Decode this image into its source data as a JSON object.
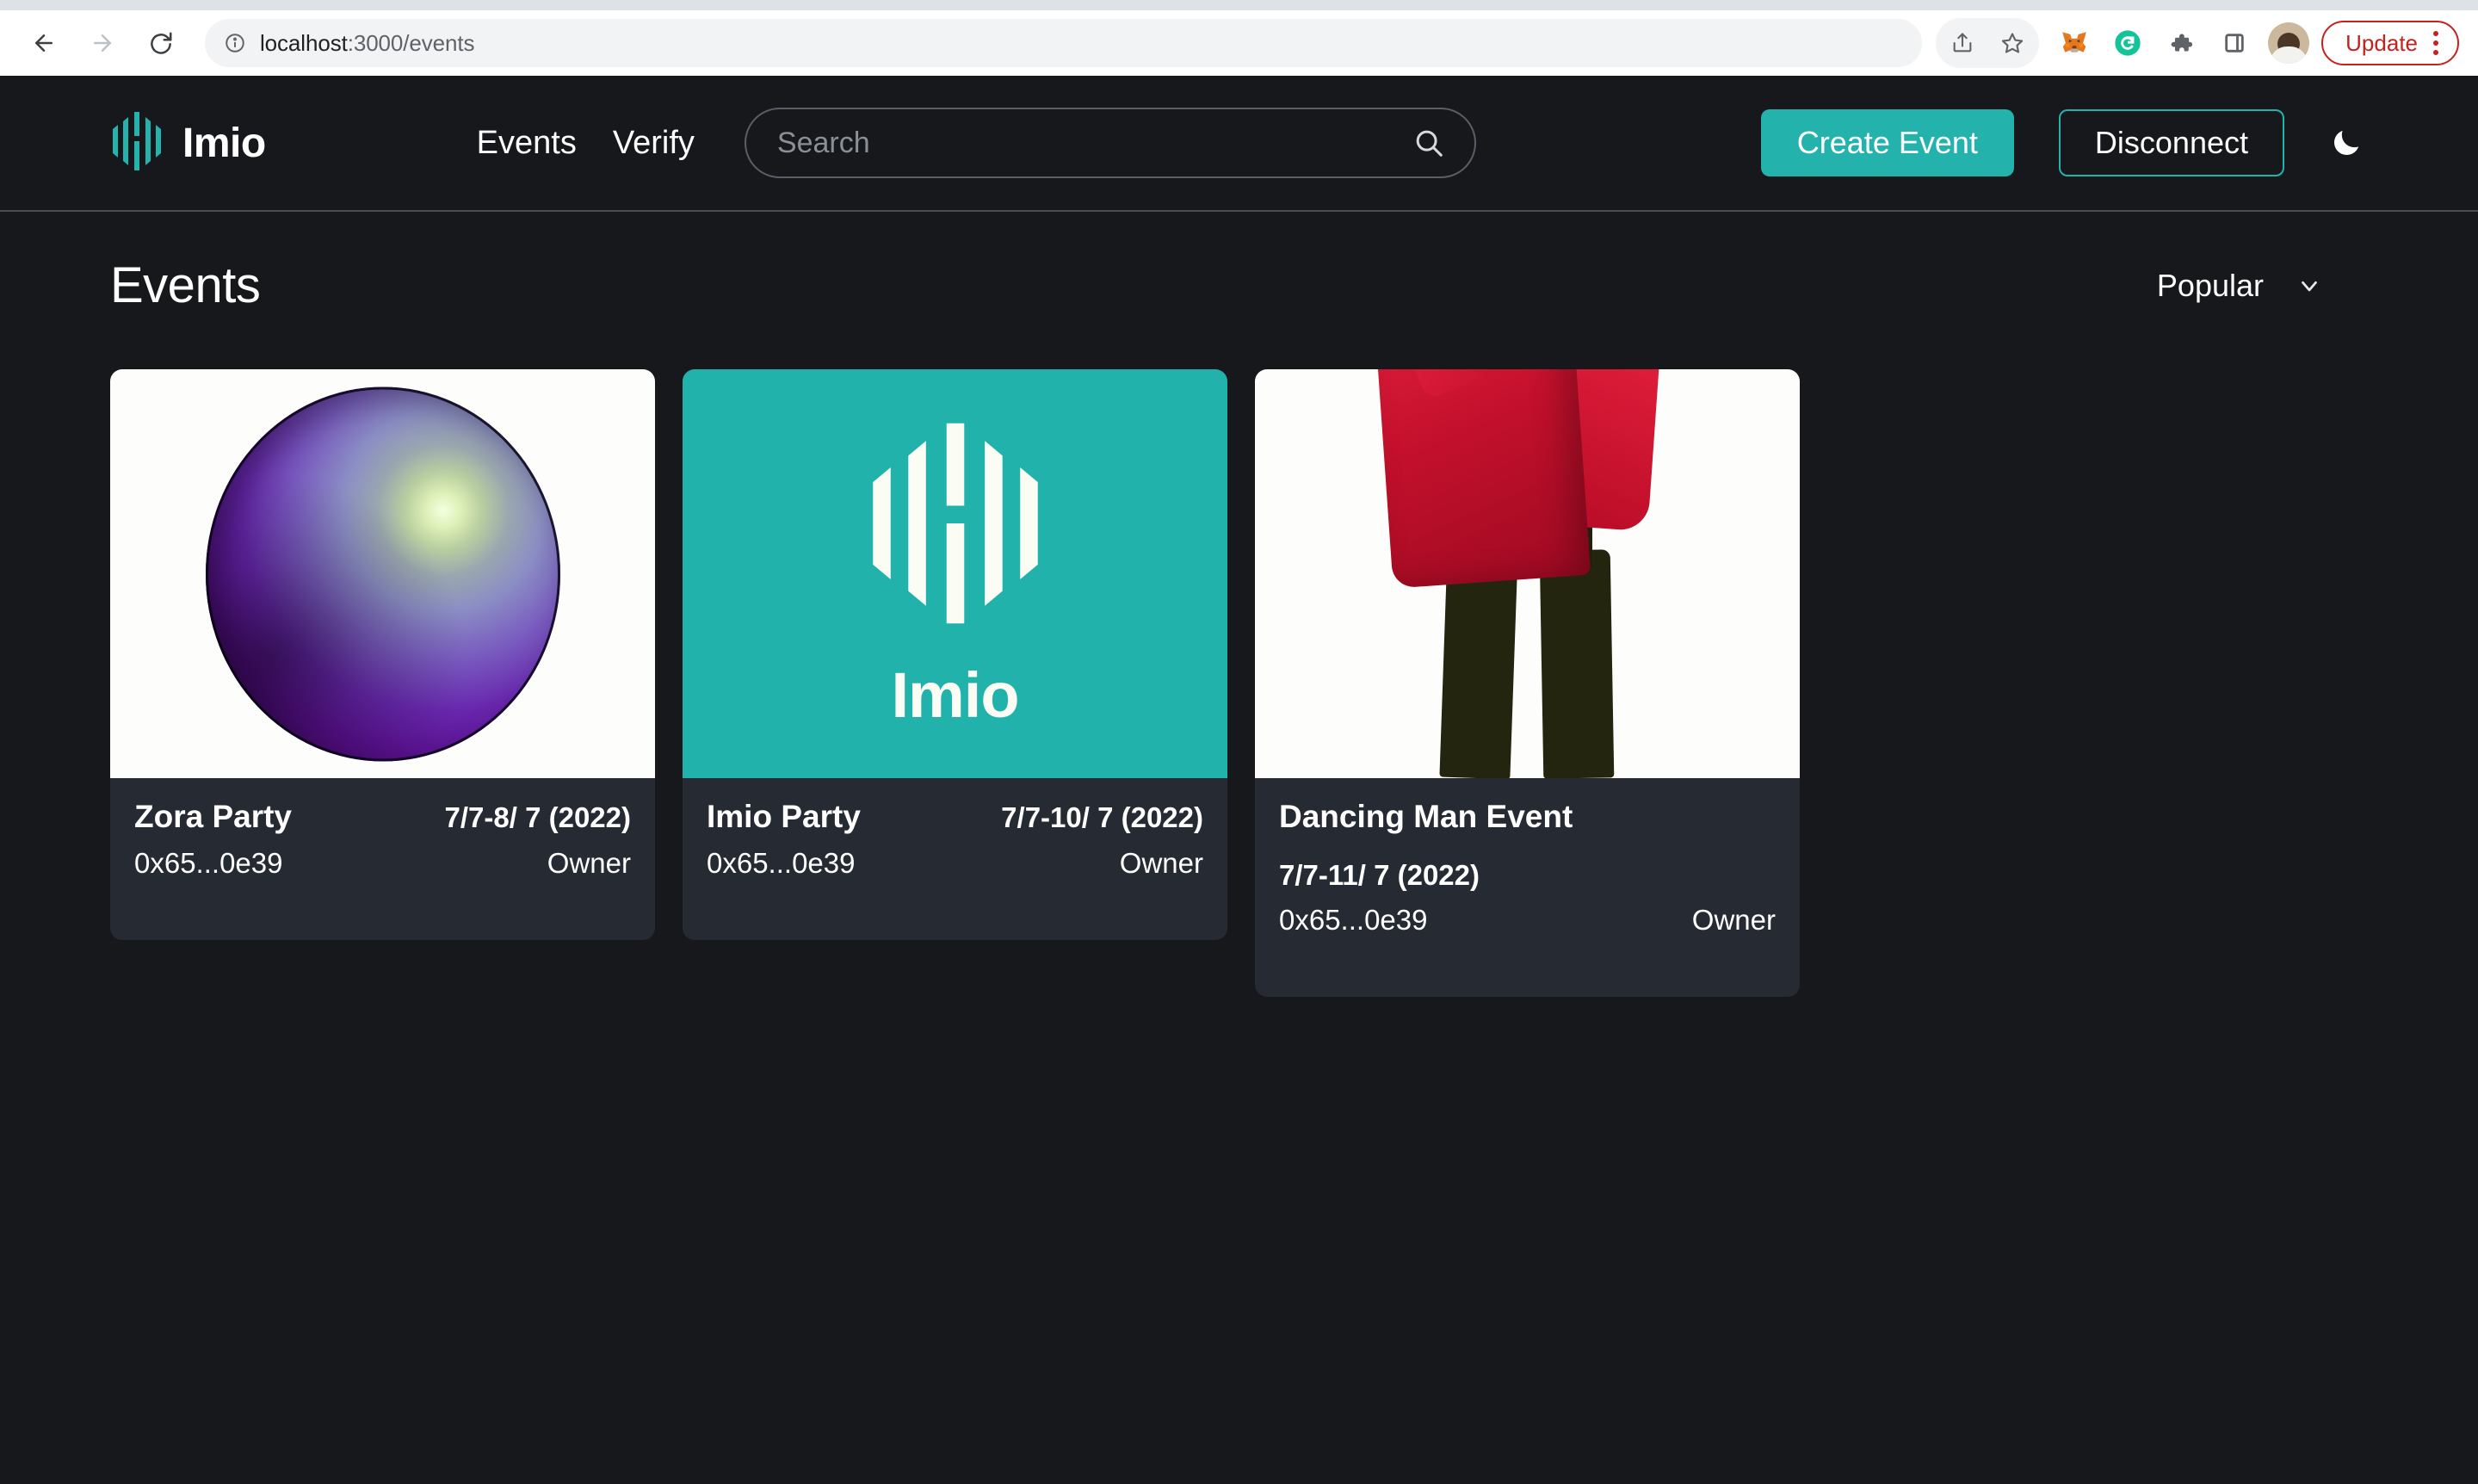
{
  "browser": {
    "back_icon": "back-arrow-icon",
    "forward_icon": "forward-arrow-icon",
    "reload_icon": "reload-icon",
    "site_info_icon": "site-info-icon",
    "url_host": "localhost",
    "url_path": ":3000/events",
    "url_full": "localhost:3000/events",
    "share_icon": "share-icon",
    "bookmark_icon": "bookmark-star-icon",
    "metamask_icon": "metamask-fox-icon",
    "grammarly_icon": "grammarly-icon",
    "extensions_icon": "extensions-puzzle-icon",
    "sidepanel_icon": "side-panel-icon",
    "avatar_icon": "profile-avatar",
    "update_label": "Update",
    "menu_icon": "three-dot-menu-icon"
  },
  "header": {
    "brand_name": "Imio",
    "logo_icon": "imio-logo-icon",
    "nav": [
      {
        "label": "Events"
      },
      {
        "label": "Verify"
      }
    ],
    "search": {
      "placeholder": "Search",
      "value": "",
      "icon": "search-icon"
    },
    "create_event_label": "Create Event",
    "disconnect_label": "Disconnect",
    "theme_toggle_icon": "moon-icon",
    "accent_color": "#24b2ad"
  },
  "main": {
    "page_title": "Events",
    "sort": {
      "label": "Popular",
      "icon": "chevron-down-icon"
    },
    "cards": [
      {
        "title": "Zora Party",
        "date": "7/7-8/ 7 (2022)",
        "address": "0x65...0e39",
        "role": "Owner",
        "media": "sphere",
        "media_bg": "#fdfdfb",
        "layout": "inline"
      },
      {
        "title": "Imio Party",
        "date": "7/7-10/ 7 (2022)",
        "address": "0x65...0e39",
        "role": "Owner",
        "media": "imio-logo",
        "media_bg": "#22b2ac",
        "media_word": "Imio",
        "layout": "inline"
      },
      {
        "title": "Dancing Man Event",
        "date": "7/7-11/ 7 (2022)",
        "address": "0x65...0e39",
        "role": "Owner",
        "media": "dancing-man",
        "media_bg": "#fdfdfb",
        "layout": "wrapped"
      }
    ]
  }
}
